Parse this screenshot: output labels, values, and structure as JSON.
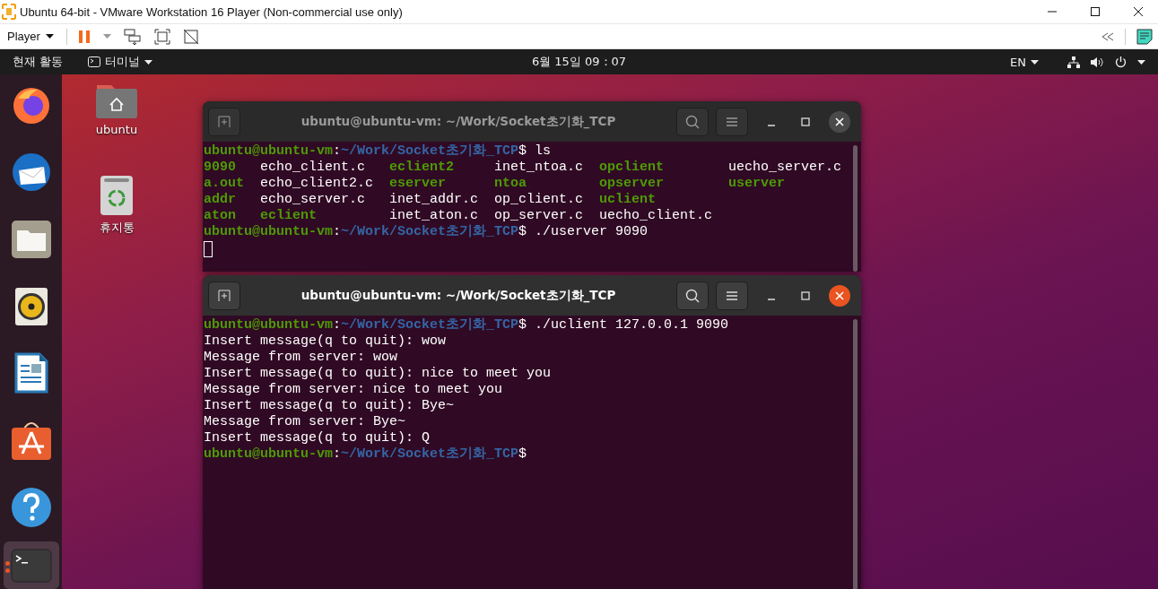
{
  "host_window": {
    "title": "Ubuntu 64-bit - VMware Workstation 16 Player (Non-commercial use only)"
  },
  "host_toolbar": {
    "player_menu": "Player"
  },
  "top_bar": {
    "activities": "현재 활동",
    "app_menu": "터미널",
    "clock": "6월 15일 09：07",
    "input_source": "EN"
  },
  "dock": [
    {
      "kind": "browser",
      "active": false
    },
    {
      "kind": "mail",
      "active": false
    },
    {
      "kind": "files",
      "active": false
    },
    {
      "kind": "music",
      "active": false
    },
    {
      "kind": "writer",
      "active": false
    },
    {
      "kind": "store",
      "active": false
    },
    {
      "kind": "help",
      "active": false
    },
    {
      "kind": "terminal",
      "active": true
    }
  ],
  "desktop_icons": [
    {
      "kind": "home",
      "label": "ubuntu"
    },
    {
      "kind": "trash",
      "label": "휴지통"
    }
  ],
  "terminals": [
    {
      "title": "ubuntu@ubuntu-vm: ~/Work/Socket초기화_TCP",
      "active": false,
      "lines": [
        {
          "kind": "prompt",
          "user": "ubuntu@ubuntu-vm",
          "sep": ":",
          "path": "~/Work/Socket초기화_TCP",
          "command": "$ ls"
        },
        {
          "kind": "ls",
          "entries": [
            {
              "name": "9090",
              "exec": true
            },
            {
              "name": "echo_client.c",
              "exec": false
            },
            {
              "name": "eclient2",
              "exec": true
            },
            {
              "name": "inet_ntoa.c",
              "exec": false
            },
            {
              "name": "opclient",
              "exec": true
            },
            {
              "name": "uecho_server.c",
              "exec": false
            }
          ]
        },
        {
          "kind": "ls",
          "entries": [
            {
              "name": "a.out",
              "exec": true
            },
            {
              "name": "echo_client2.c",
              "exec": false
            },
            {
              "name": "eserver",
              "exec": true
            },
            {
              "name": "ntoa",
              "exec": true
            },
            {
              "name": "opserver",
              "exec": true
            },
            {
              "name": "userver",
              "exec": true
            }
          ]
        },
        {
          "kind": "ls",
          "entries": [
            {
              "name": "addr",
              "exec": true
            },
            {
              "name": "echo_server.c",
              "exec": false
            },
            {
              "name": "inet_addr.c",
              "exec": false
            },
            {
              "name": "op_client.c",
              "exec": false
            },
            {
              "name": "uclient",
              "exec": true
            }
          ]
        },
        {
          "kind": "ls",
          "entries": [
            {
              "name": "aton",
              "exec": true
            },
            {
              "name": "eclient",
              "exec": true
            },
            {
              "name": "inet_aton.c",
              "exec": false
            },
            {
              "name": "op_server.c",
              "exec": false
            },
            {
              "name": "uecho_client.c",
              "exec": false
            }
          ]
        },
        {
          "kind": "prompt",
          "user": "ubuntu@ubuntu-vm",
          "sep": ":",
          "path": "~/Work/Socket초기화_TCP",
          "command": "$ ./userver 9090"
        },
        {
          "kind": "cursor"
        }
      ]
    },
    {
      "title": "ubuntu@ubuntu-vm: ~/Work/Socket초기화_TCP",
      "active": true,
      "lines": [
        {
          "kind": "prompt",
          "user": "ubuntu@ubuntu-vm",
          "sep": ":",
          "path": "~/Work/Socket초기화_TCP",
          "command": "$ ./uclient 127.0.0.1 9090"
        },
        {
          "kind": "output",
          "text": "Insert message(q to quit): wow"
        },
        {
          "kind": "output",
          "text": "Message from server: wow"
        },
        {
          "kind": "output",
          "text": "Insert message(q to quit): nice to meet you"
        },
        {
          "kind": "output",
          "text": "Message from server: nice to meet you"
        },
        {
          "kind": "output",
          "text": "Insert message(q to quit): Bye~"
        },
        {
          "kind": "output",
          "text": "Message from server: Bye~"
        },
        {
          "kind": "output",
          "text": "Insert message(q to quit): Q"
        },
        {
          "kind": "prompt",
          "user": "ubuntu@ubuntu-vm",
          "sep": ":",
          "path": "~/Work/Socket초기화_TCP",
          "command": "$"
        }
      ]
    }
  ]
}
